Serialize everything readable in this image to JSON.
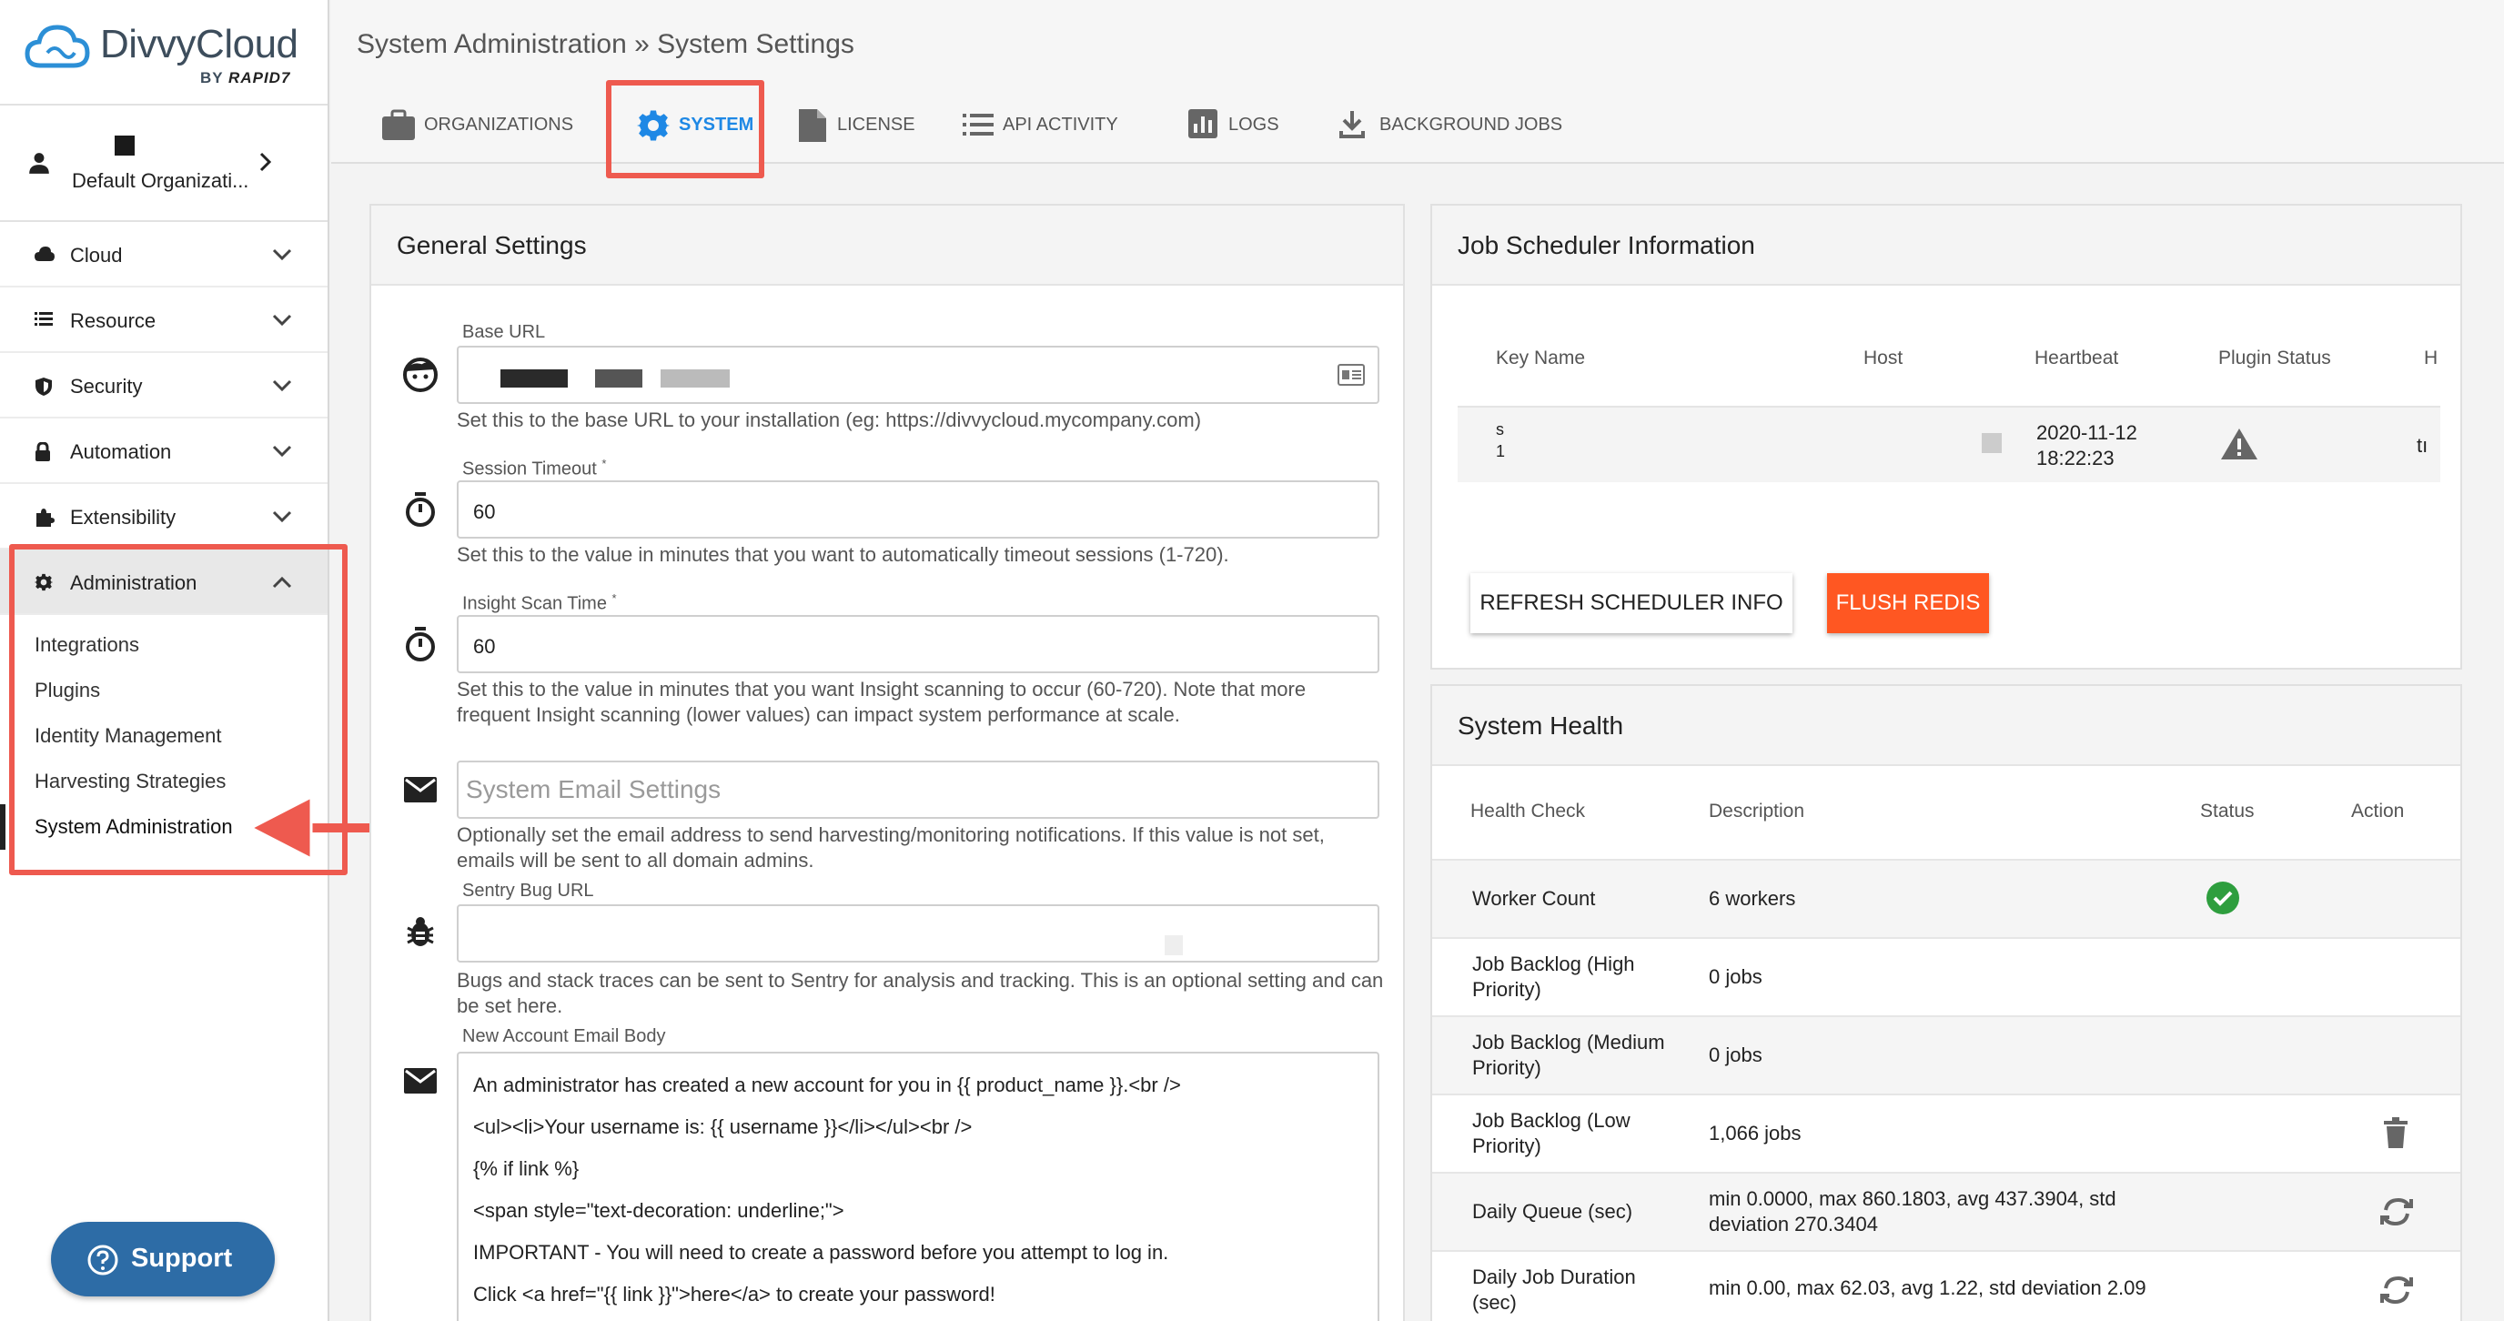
{
  "brand": {
    "name": "DivvyCloud",
    "by": "BY",
    "by_brand": "RAPID7"
  },
  "org": {
    "name": "Default Organizati..."
  },
  "nav": [
    {
      "label": "Cloud",
      "icon": "cloud-icon"
    },
    {
      "label": "Resource",
      "icon": "list-icon"
    },
    {
      "label": "Security",
      "icon": "shield-icon"
    },
    {
      "label": "Automation",
      "icon": "lock-icon"
    },
    {
      "label": "Extensibility",
      "icon": "puzzle-icon"
    },
    {
      "label": "Administration",
      "icon": "gear-icon"
    }
  ],
  "admin_sub": [
    "Integrations",
    "Plugins",
    "Identity Management",
    "Harvesting Strategies",
    "System Administration"
  ],
  "support": {
    "label": "Support"
  },
  "header": {
    "breadcrumb": "System Administration » System Settings"
  },
  "tabs": [
    "ORGANIZATIONS",
    "SYSTEM",
    "LICENSE",
    "API ACTIVITY",
    "LOGS",
    "BACKGROUND JOBS"
  ],
  "general": {
    "title": "General Settings",
    "base_url": {
      "label": "Base URL",
      "help": "Set this to the base URL to your installation (eg: https://divvycloud.mycompany.com)"
    },
    "session_timeout": {
      "label": "Session Timeout",
      "value": "60",
      "help": "Set this to the value in minutes that you want to automatically timeout sessions (1-720)."
    },
    "insight_scan": {
      "label": "Insight Scan Time",
      "value": "60",
      "help1": "Set this to the value in minutes that you want Insight scanning to occur (60-720). Note that more",
      "help2": "frequent Insight scanning (lower values) can impact system performance at scale."
    },
    "email": {
      "placeholder": "System Email Settings",
      "help1": "Optionally set the email address to send harvesting/monitoring notifications. If this value is not set,",
      "help2": "emails will be sent to all domain admins."
    },
    "sentry": {
      "label": "Sentry Bug URL",
      "help1": "Bugs and stack traces can be sent to Sentry for analysis and tracking. This is an optional setting and can",
      "help2": "be set here."
    },
    "new_account": {
      "label": "New Account Email Body",
      "lines": [
        "An administrator has created a new account for you in {{ product_name }}.<br />",
        "<ul><li>Your username is: {{ username }}</li></ul><br />",
        "{% if link %}",
        "<span style=\"text-decoration: underline;\">",
        "IMPORTANT - You will need to create a password before you attempt to log in.",
        "Click <a href=\"{{ link }}\">here</a> to create your password!"
      ]
    }
  },
  "scheduler": {
    "title": "Job Scheduler Information",
    "columns": [
      "Key Name",
      "Host",
      "Heartbeat",
      "Plugin Status",
      "H"
    ],
    "row": {
      "key1": "s",
      "key2": "1",
      "heartbeat1": "2020-11-12",
      "heartbeat2": "18:22:23",
      "h": "tı"
    },
    "refresh": "REFRESH SCHEDULER INFO",
    "flush": "FLUSH REDIS"
  },
  "health": {
    "title": "System Health",
    "columns": [
      "Health Check",
      "Description",
      "Status",
      "Action"
    ],
    "rows": [
      {
        "check": "Worker Count",
        "desc": "6 workers",
        "status": "ok",
        "action": ""
      },
      {
        "check": "Job Backlog (High Priority)",
        "desc": "0 jobs",
        "status": "",
        "action": ""
      },
      {
        "check": "Job Backlog (Medium Priority)",
        "desc": "0 jobs",
        "status": "",
        "action": ""
      },
      {
        "check": "Job Backlog (Low Priority)",
        "desc": "1,066 jobs",
        "status": "",
        "action": "trash"
      },
      {
        "check": "Daily Queue (sec)",
        "desc": "min 0.0000, max 860.1803, avg 437.3904, std deviation 270.3404",
        "status": "",
        "action": "refresh"
      },
      {
        "check": "Daily Job Duration (sec)",
        "desc": "min 0.00, max 62.03, avg 1.22, std deviation 2.09",
        "status": "",
        "action": "refresh"
      }
    ]
  },
  "colors": {
    "accent": "#1e88e5",
    "flush": "#ff5722",
    "highlight": "#ee5a4f",
    "support": "#2d6ca6",
    "ok": "#2e9e3e"
  }
}
